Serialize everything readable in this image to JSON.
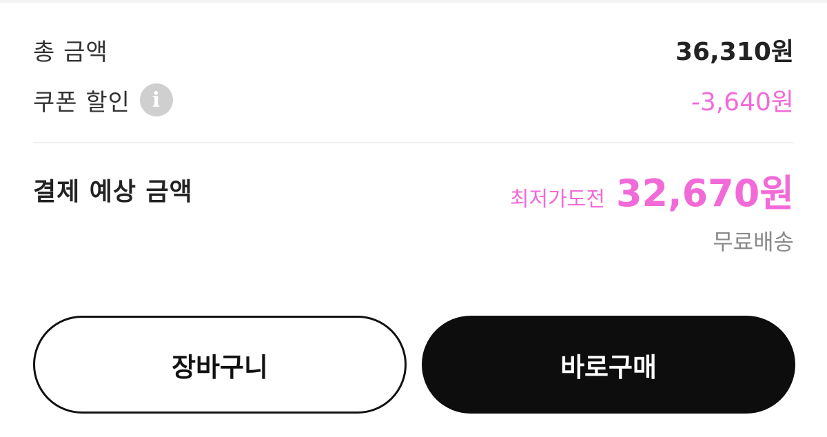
{
  "summary": {
    "total_label": "총 금액",
    "total_value": "36,310원",
    "coupon_label": "쿠폰 할인",
    "coupon_info_glyph": "i",
    "coupon_value": "-3,640원",
    "expected_label": "결제 예상 금액",
    "challenge_label": "최저가도전",
    "expected_value": "32,670원",
    "shipping_label": "무료배송"
  },
  "actions": {
    "cart_label": "장바구니",
    "buy_label": "바로구매"
  },
  "colors": {
    "accent_pink": "#f26ad8",
    "button_dark": "#0d0d0e",
    "info_icon_gray": "#cfcfcf",
    "muted_text": "#8a8a8a"
  },
  "icons": {
    "coupon_info": "info-icon"
  }
}
